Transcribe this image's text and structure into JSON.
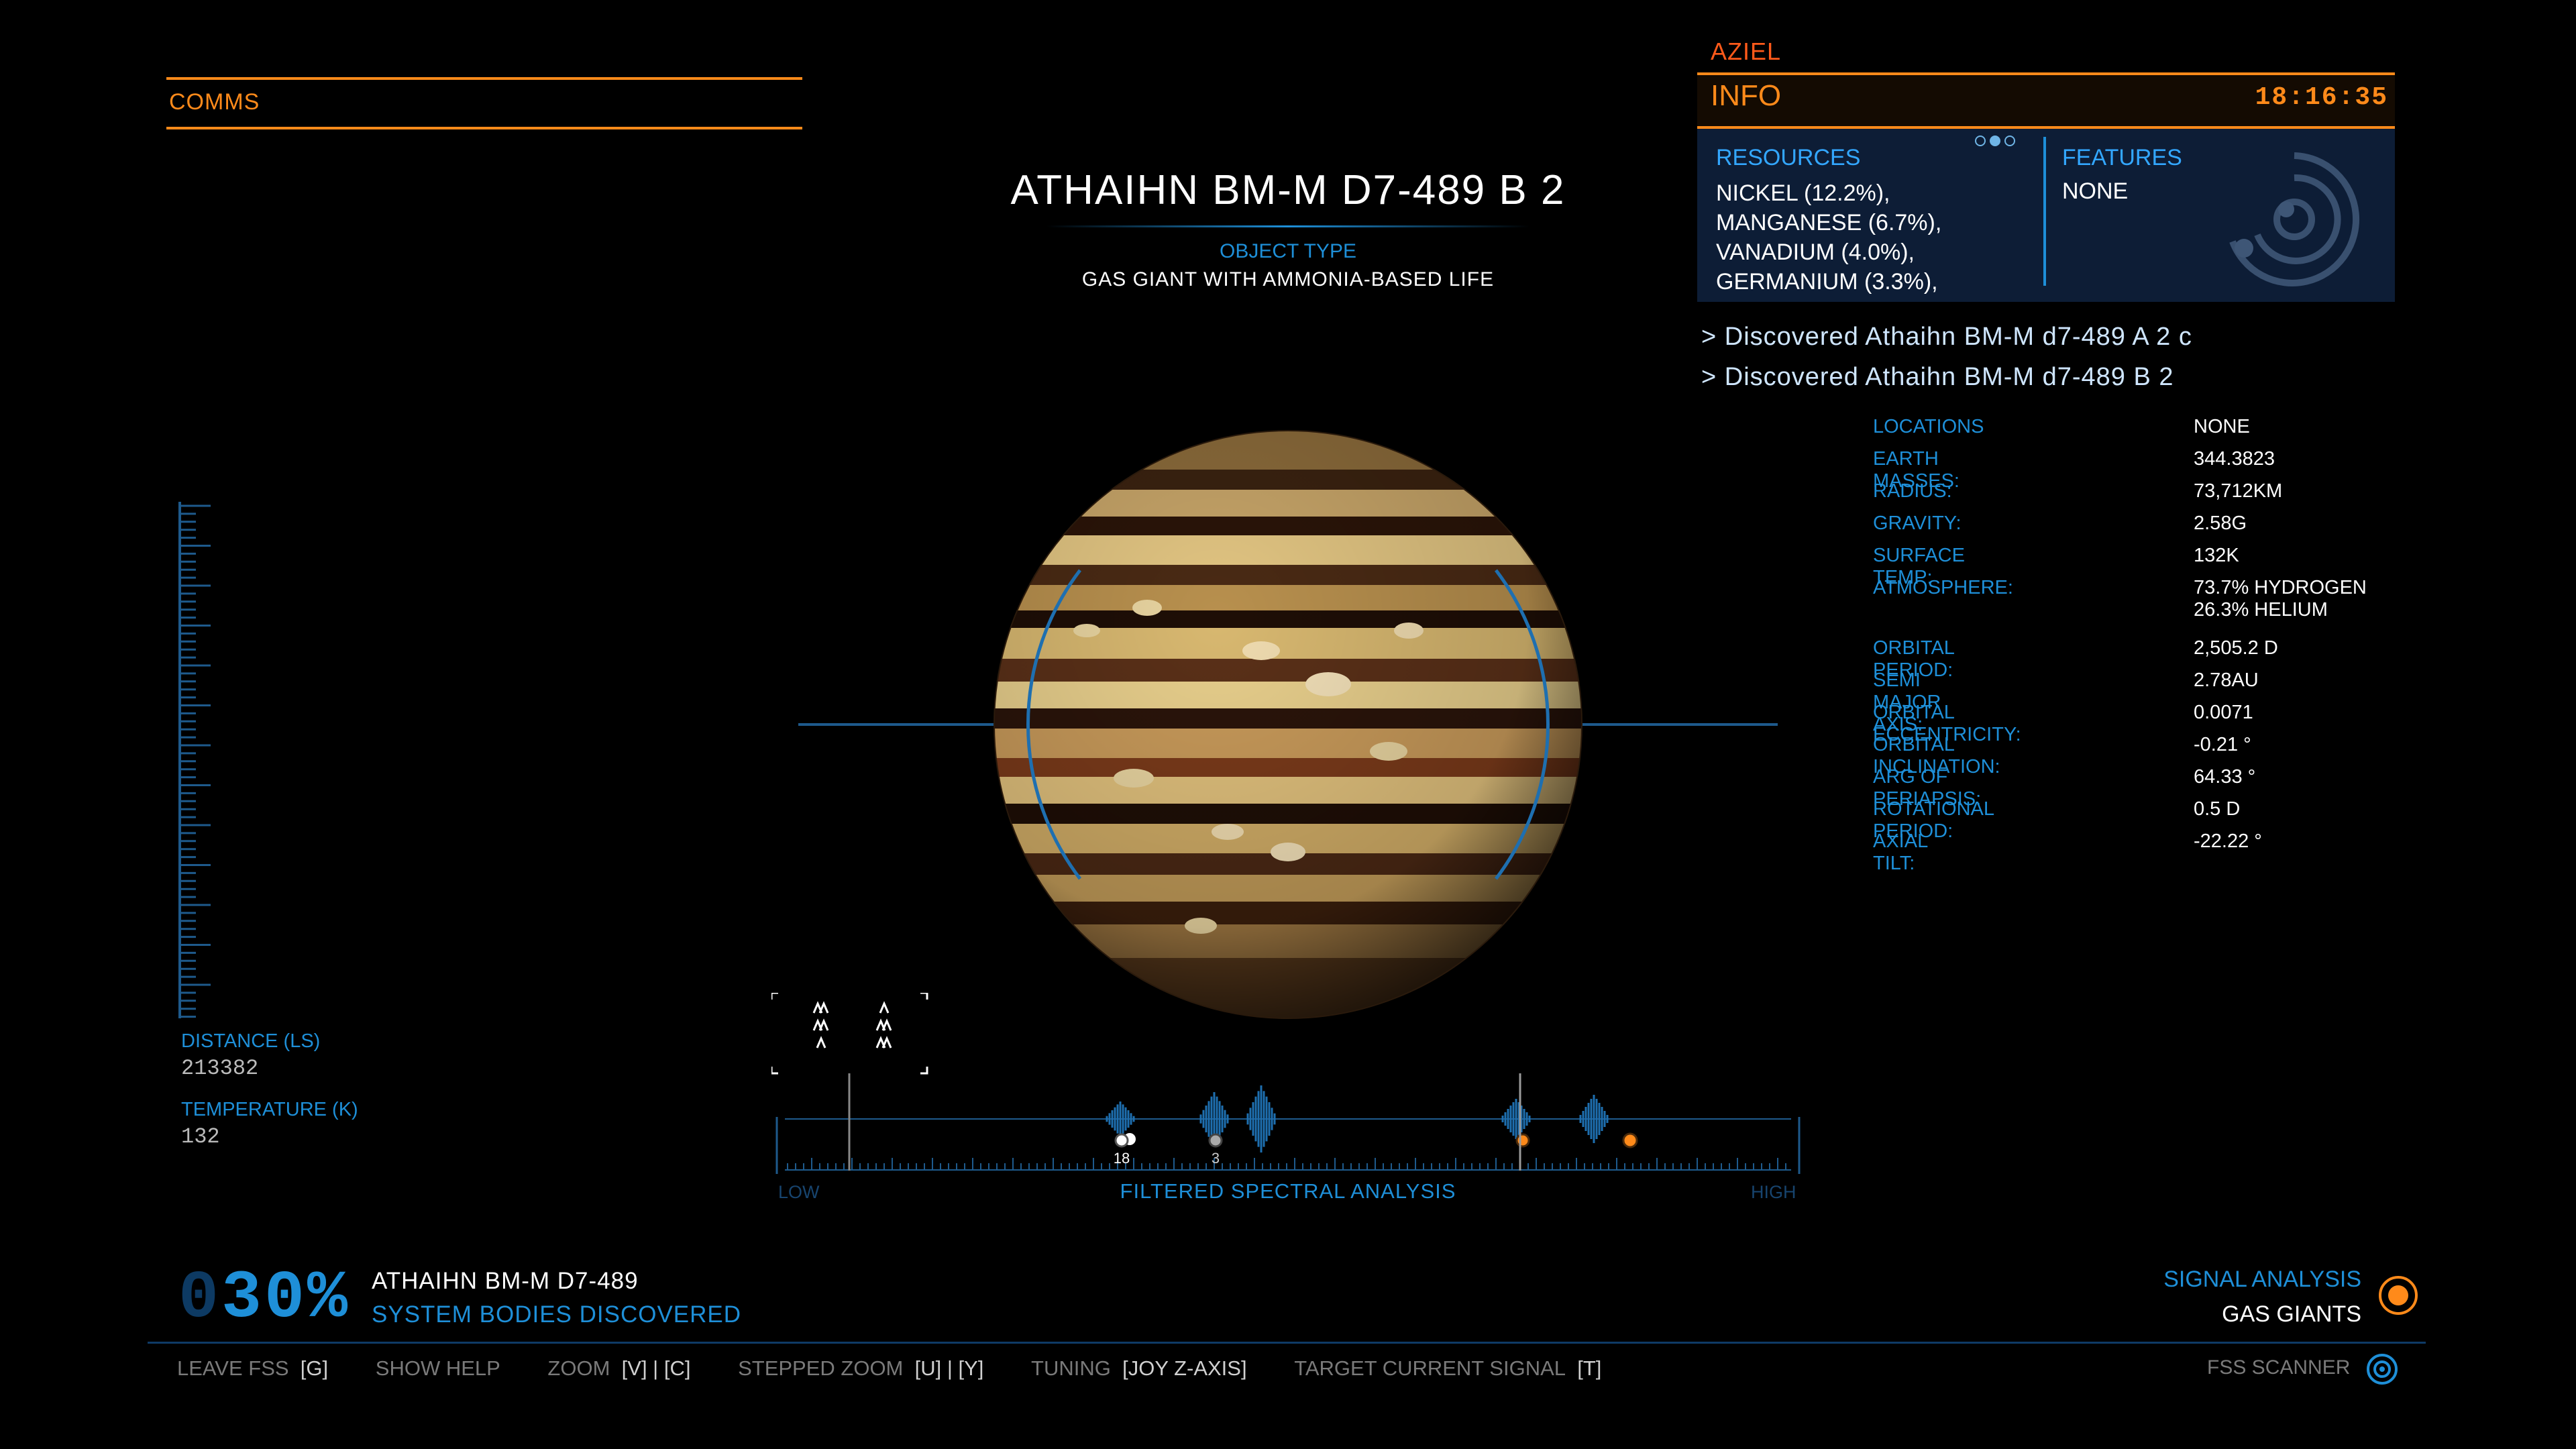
{
  "comms": {
    "label": "COMMS"
  },
  "body": {
    "title": "ATHAIHN BM-M D7-489 B 2",
    "object_type_label": "OBJECT TYPE",
    "object_type": "GAS GIANT WITH AMMONIA-BASED LIFE"
  },
  "info_panel": {
    "commander": "AZIEL",
    "tab": "INFO",
    "clock": "18:16:35",
    "resources_label": "RESOURCES",
    "resources": [
      "NICKEL (12.2%),",
      "MANGANESE (6.7%),",
      "VANADIUM (4.0%),",
      "GERMANIUM (3.3%),"
    ],
    "features_label": "FEATURES",
    "features_value": "NONE",
    "features_icon": "radar-icon",
    "discovered": [
      "> Discovered Athaihn BM-M d7-489 A 2 c",
      "> Discovered Athaihn BM-M d7-489 B 2"
    ]
  },
  "stats": [
    {
      "k": "LOCATIONS",
      "v": "NONE"
    },
    {
      "k": "EARTH MASSES:",
      "v": "344.3823"
    },
    {
      "k": "RADIUS:",
      "v": "73,712KM"
    },
    {
      "k": "GRAVITY:",
      "v": "2.58G"
    },
    {
      "k": "SURFACE TEMP:",
      "v": "132K"
    },
    {
      "k": "ATMOSPHERE:",
      "v": "73.7% HYDROGEN",
      "v2": "26.3% HELIUM"
    },
    {
      "k": "ORBITAL PERIOD:",
      "v": "2,505.2 D"
    },
    {
      "k": "SEMI MAJOR AXIS:",
      "v": "2.78AU"
    },
    {
      "k": "ORBITAL ECCENTRICITY:",
      "v": "0.0071"
    },
    {
      "k": "ORBITAL INCLINATION:",
      "v": "-0.21 °"
    },
    {
      "k": "ARG OF PERIAPSIS:",
      "v": "64.33 °"
    },
    {
      "k": "ROTATIONAL PERIOD:",
      "v": "0.5 D"
    },
    {
      "k": "AXIAL TILT:",
      "v": "-22.22 °"
    }
  ],
  "left_readout": {
    "distance_label": "DISTANCE (LS)",
    "distance": "213382",
    "temperature_label": "TEMPERATURE (K)",
    "temperature": "132"
  },
  "spectrum": {
    "low": "LOW",
    "high": "HIGH",
    "label": "FILTERED SPECTRAL ANALYSIS",
    "marker_counts": [
      "18",
      "3"
    ]
  },
  "discovery": {
    "percent_dim": "0",
    "percent": "30%",
    "system": "ATHAIHN BM-M D7-489",
    "caption": "SYSTEM BODIES DISCOVERED"
  },
  "signal": {
    "label": "SIGNAL ANALYSIS",
    "value": "GAS GIANTS"
  },
  "controls": [
    {
      "label": "LEAVE FSS",
      "key": "[G]"
    },
    {
      "label": "SHOW HELP",
      "key": ""
    },
    {
      "label": "ZOOM",
      "key": "[V] | [C]"
    },
    {
      "label": "STEPPED ZOOM",
      "key": "[U] | [Y]"
    },
    {
      "label": "TUNING",
      "key": "[JOY Z-AXIS]"
    },
    {
      "label": "TARGET CURRENT SIGNAL",
      "key": "[T]"
    }
  ],
  "fss": {
    "label": "FSS SCANNER"
  },
  "colors": {
    "accent_orange": "#ff8a1a",
    "accent_blue": "#1e8fd8",
    "panel_bg": "#0d1d36"
  }
}
